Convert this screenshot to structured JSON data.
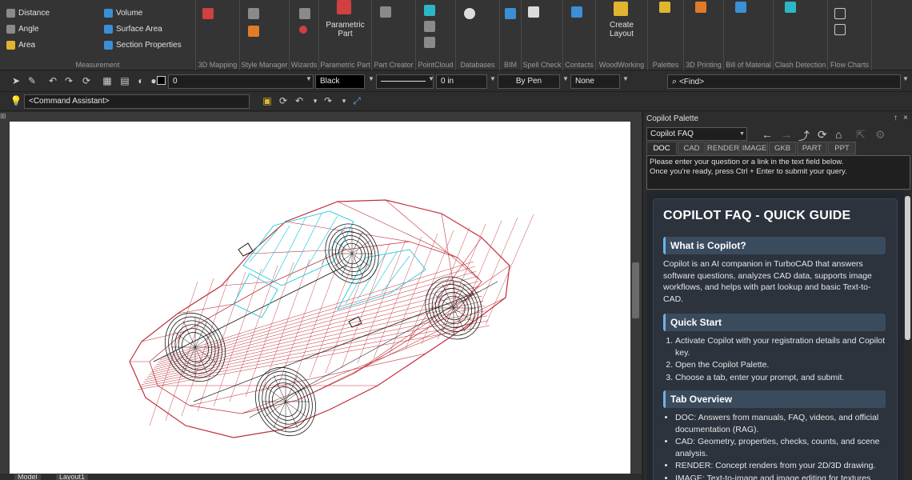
{
  "ribbon": {
    "measurement": {
      "items": [
        "Distance",
        "Angle",
        "Area",
        "Volume",
        "Surface Area",
        "Section Properties"
      ],
      "group_label": "Measurement"
    },
    "parametric_part_label_1": "Parametric",
    "parametric_part_label_2": "Part",
    "create_layout_label_1": "Create",
    "create_layout_label_2": "Layout",
    "groups": [
      "3D Mapping",
      "Style Manager",
      "Wizards",
      "Parametric Part",
      "Part Creator",
      "PointCloud",
      "Databases",
      "BIM",
      "Spell Check",
      "Contacts",
      "WoodWorking",
      "Palettes",
      "3D Printing",
      "Bill of Material",
      "Clash Detection",
      "Flow Charts"
    ]
  },
  "toolbar": {
    "layer_value": "0",
    "color_value": "Black",
    "width_value": "0 in",
    "pen_value": "By Pen",
    "style_value": "None",
    "find_placeholder": "<Find>",
    "command_assistant": "<Command Assistant>"
  },
  "layout_tabs": [
    "Model",
    "Layout1"
  ],
  "palette": {
    "title": "Copilot Palette",
    "pin": "↑",
    "close": "×",
    "selector_value": "Copilot FAQ",
    "tabs": [
      "DOC",
      "CAD",
      "RENDER",
      "IMAGE",
      "GKB",
      "PART",
      "PPT"
    ],
    "active_tab": "DOC",
    "input_line_1": "Please enter your question or a link in the text field below.",
    "input_line_2": "Once you're ready, press Ctrl + Enter to submit your query.",
    "faq": {
      "title": "COPILOT FAQ - QUICK GUIDE",
      "sections": [
        {
          "heading": "What is Copilot?",
          "text": "Copilot is an AI companion in TurboCAD that answers software questions, analyzes CAD data, supports image workflows, and helps with part lookup and basic Text-to-CAD."
        },
        {
          "heading": "Quick Start",
          "steps": [
            "Activate Copilot with your registration details and Copilot key.",
            "Open the Copilot Palette.",
            "Choose a tab, enter your prompt, and submit."
          ]
        },
        {
          "heading": "Tab Overview",
          "bullets": [
            "DOC: Answers from manuals, FAQ, videos, and official documentation (RAG).",
            "CAD: Geometry, properties, checks, counts, and scene analysis.",
            "RENDER: Concept renders from your 2D/3D drawing.",
            "IMAGE: Text-to-image and image editing for textures"
          ]
        }
      ]
    }
  },
  "colors": {
    "wire_red": "#c0303a",
    "wire_black": "#1a1a1a",
    "wire_cyan": "#1fc8d8",
    "accent_blue": "#6fb2ea"
  }
}
